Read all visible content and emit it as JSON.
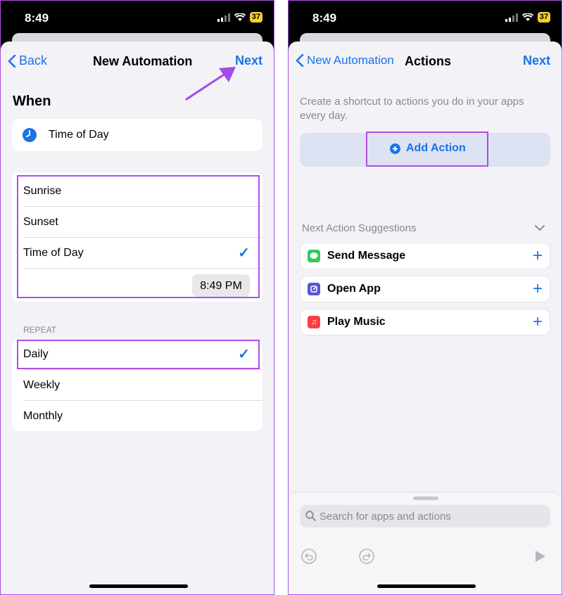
{
  "left": {
    "status": {
      "time": "8:49",
      "battery": "37"
    },
    "nav": {
      "back": "Back",
      "title": "New Automation",
      "next": "Next"
    },
    "when_title": "When",
    "trigger": {
      "label": "Time of Day",
      "icon": "clock-icon"
    },
    "time_options": [
      "Sunrise",
      "Sunset",
      "Time of Day"
    ],
    "selected_option": "Time of Day",
    "time_value": "8:49 PM",
    "repeat_label": "REPEAT",
    "repeat_options": [
      "Daily",
      "Weekly",
      "Monthly"
    ],
    "selected_repeat": "Daily"
  },
  "right": {
    "status": {
      "time": "8:49",
      "battery": "37"
    },
    "nav": {
      "back": "New Automation",
      "title": "Actions",
      "next": "Next"
    },
    "description": "Create a shortcut to actions you do in your apps every day.",
    "add_action": "Add Action",
    "suggestions_title": "Next Action Suggestions",
    "suggestions": [
      {
        "label": "Send Message",
        "icon": "messages-icon",
        "color": "#34c759"
      },
      {
        "label": "Open App",
        "icon": "open-app-icon",
        "color": "#5856d6"
      },
      {
        "label": "Play Music",
        "icon": "music-icon",
        "color": "#fc3c44"
      }
    ],
    "search_placeholder": "Search for apps and actions"
  },
  "colors": {
    "accent": "#1a73e8",
    "highlight": "#b04de0",
    "background": "#f2f2f7"
  }
}
